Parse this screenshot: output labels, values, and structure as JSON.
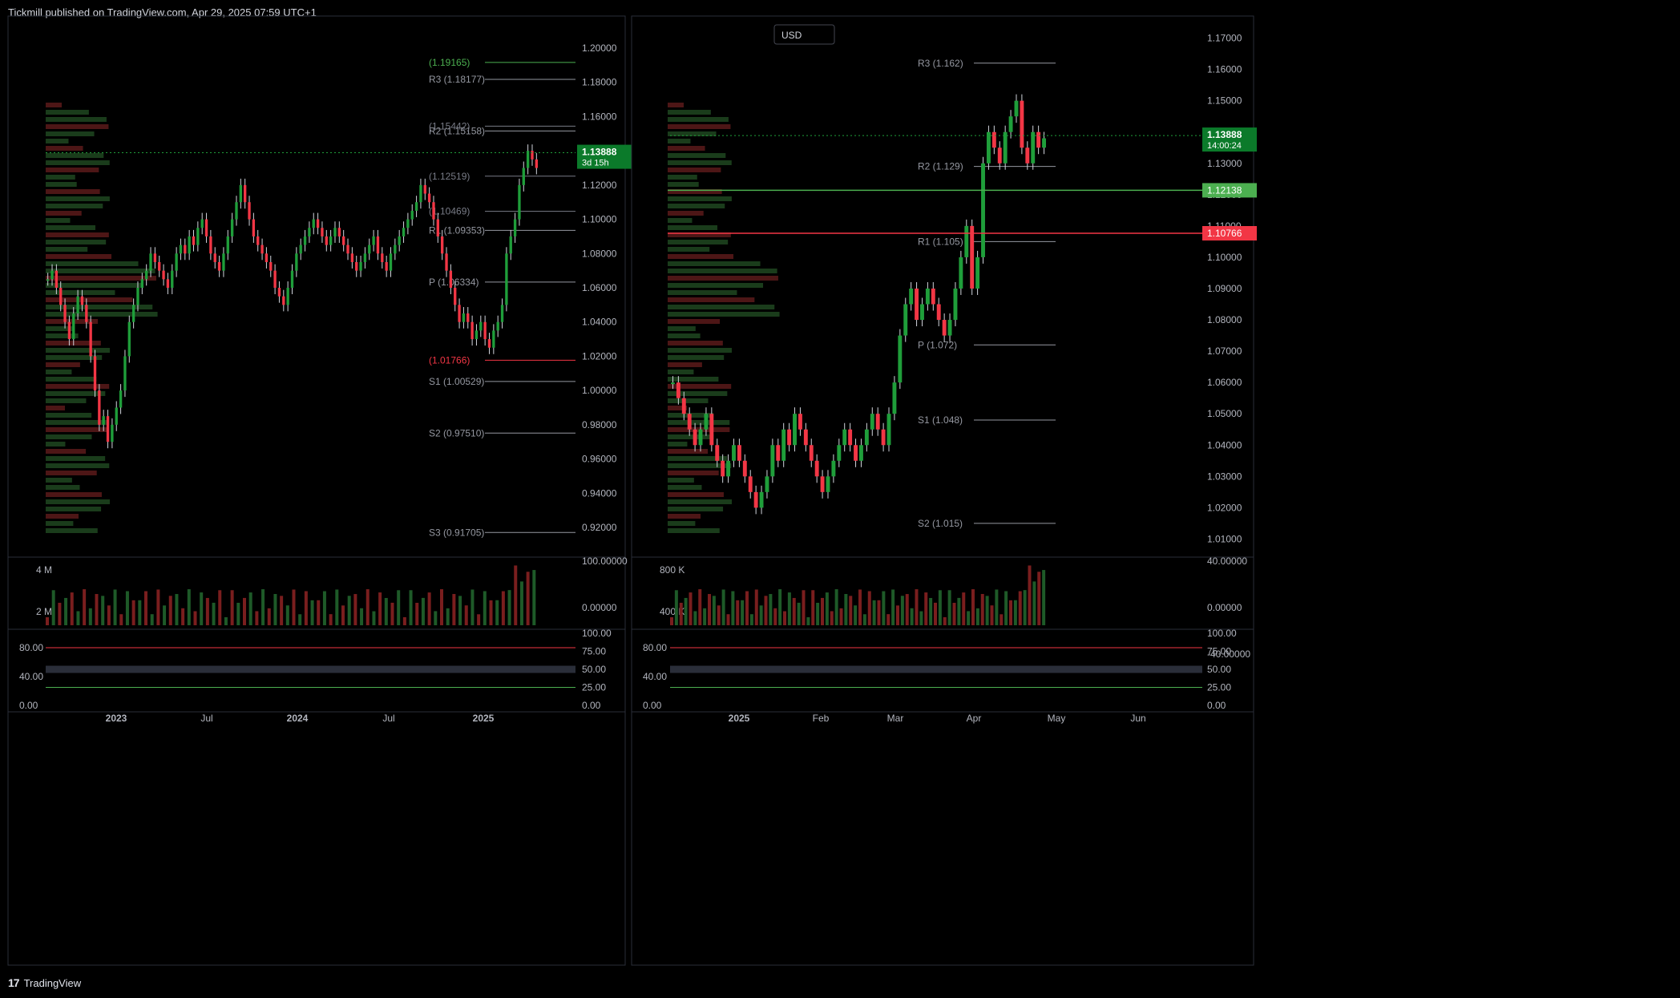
{
  "header": {
    "text": "Tickmill published on TradingView.com, Apr 29, 2025 07:59 UTC+1"
  },
  "footer": {
    "logo": "17",
    "brand": "TradingView"
  },
  "colors": {
    "bg": "#000000",
    "up": "#089981",
    "upBody": "#1f9e3a",
    "down": "#f23645",
    "grid": "#1c1c1c",
    "axis": "#b2b5be",
    "border": "#2a2e39"
  },
  "chart_data": [
    {
      "type": "candlestick",
      "name_on_chart": "",
      "currency_badge": "USD",
      "y_ticks": [
        "1.20000",
        "1.18000",
        "1.16000",
        "1.14000",
        "1.12000",
        "1.10000",
        "1.08000",
        "1.06000",
        "1.04000",
        "1.02000",
        "1.00000",
        "0.98000",
        "0.96000",
        "0.94000",
        "0.92000"
      ],
      "ylim": [
        0.905,
        1.215
      ],
      "x_labels": [
        "2023",
        "Jul",
        "2024",
        "Jul",
        "2025"
      ],
      "price_label": {
        "value": "1.13888",
        "sub": "3d 15h",
        "price": 1.13888
      },
      "levels": [
        {
          "label": "(1.19165)",
          "value": 1.19165,
          "color": "#4caf50"
        },
        {
          "label": "R3 (1.18177)",
          "value": 1.18177,
          "color": "#9598a1"
        },
        {
          "label": "R2 (1.15158)",
          "value": 1.15158,
          "color": "#9598a1"
        },
        {
          "label": "(1.15442)",
          "value": 1.15442,
          "color": "#787b86"
        },
        {
          "label": "(1.12519)",
          "value": 1.12519,
          "color": "#787b86"
        },
        {
          "label": "(1.10469)",
          "value": 1.10469,
          "color": "#787b86"
        },
        {
          "label": "R1 (1.09353)",
          "value": 1.09353,
          "color": "#9598a1"
        },
        {
          "label": "P (1.06334)",
          "value": 1.06334,
          "color": "#9598a1"
        },
        {
          "label": "(1.01766)",
          "value": 1.01766,
          "color": "#f23645"
        },
        {
          "label": "S1 (1.00529)",
          "value": 1.00529,
          "color": "#9598a1"
        },
        {
          "label": "S2 (0.97510)",
          "value": 0.9751,
          "color": "#9598a1"
        },
        {
          "label": "S3 (0.91705)",
          "value": 0.91705,
          "color": "#9598a1"
        }
      ],
      "candles": [
        1.065,
        1.07,
        1.06,
        1.05,
        1.04,
        1.03,
        1.045,
        1.055,
        1.05,
        1.04,
        1.02,
        1.0,
        0.98,
        0.985,
        0.97,
        0.98,
        0.99,
        1.0,
        1.02,
        1.04,
        1.05,
        1.06,
        1.065,
        1.07,
        1.08,
        1.075,
        1.07,
        1.065,
        1.06,
        1.07,
        1.08,
        1.085,
        1.08,
        1.09,
        1.085,
        1.095,
        1.1,
        1.09,
        1.08,
        1.075,
        1.07,
        1.08,
        1.09,
        1.1,
        1.11,
        1.12,
        1.11,
        1.1,
        1.09,
        1.085,
        1.08,
        1.075,
        1.07,
        1.06,
        1.055,
        1.05,
        1.06,
        1.07,
        1.08,
        1.085,
        1.09,
        1.095,
        1.1,
        1.095,
        1.09,
        1.085,
        1.09,
        1.095,
        1.09,
        1.085,
        1.08,
        1.075,
        1.07,
        1.075,
        1.08,
        1.085,
        1.09,
        1.08,
        1.075,
        1.07,
        1.08,
        1.085,
        1.09,
        1.095,
        1.1,
        1.105,
        1.11,
        1.12,
        1.115,
        1.11,
        1.1,
        1.09,
        1.08,
        1.07,
        1.06,
        1.05,
        1.04,
        1.045,
        1.04,
        1.03,
        1.035,
        1.04,
        1.03,
        1.025,
        1.035,
        1.04,
        1.05,
        1.08,
        1.09,
        1.1,
        1.12,
        1.13,
        1.14,
        1.135,
        1.13
      ],
      "volume_ticks": [
        "4 M",
        "2 M"
      ],
      "volume_right_ticks": [
        "100.00000",
        "0.00000"
      ],
      "osc_ticks": [
        "80.00",
        "40.00",
        "0.00"
      ],
      "osc_right_ticks": [
        "100.00",
        "75.00",
        "50.00",
        "25.00",
        "0.00"
      ]
    },
    {
      "type": "candlestick",
      "name_on_chart": "",
      "y_ticks": [
        "1.17000",
        "1.16000",
        "1.15000",
        "1.14000",
        "1.13000",
        "1.12000",
        "1.11000",
        "1.10000",
        "1.09000",
        "1.08000",
        "1.07000",
        "1.06000",
        "1.05000",
        "1.04000",
        "1.03000",
        "1.02000",
        "1.01000"
      ],
      "ylim": [
        1.0055,
        1.175
      ],
      "x_labels": [
        "2025",
        "Feb",
        "Mar",
        "Apr",
        "May",
        "Jun"
      ],
      "price_label": {
        "value": "1.13888",
        "sub": "14:00:24",
        "price": 1.13888
      },
      "side_labels": [
        {
          "value": "1.12138",
          "price": 1.12138,
          "color": "#4caf50"
        },
        {
          "value": "1.10766",
          "price": 1.10766,
          "color": "#f23645"
        }
      ],
      "levels": [
        {
          "label": "R3 (1.162)",
          "value": 1.162,
          "color": "#9598a1"
        },
        {
          "label": "R2 (1.129)",
          "value": 1.129,
          "color": "#9598a1"
        },
        {
          "label": "R1 (1.105)",
          "value": 1.105,
          "color": "#9598a1"
        },
        {
          "label": "P (1.072)",
          "value": 1.072,
          "color": "#9598a1"
        },
        {
          "label": "S1 (1.048)",
          "value": 1.048,
          "color": "#9598a1"
        },
        {
          "label": "S2 (1.015)",
          "value": 1.015,
          "color": "#9598a1"
        }
      ],
      "candles": [
        1.06,
        1.055,
        1.05,
        1.045,
        1.04,
        1.045,
        1.05,
        1.04,
        1.035,
        1.03,
        1.035,
        1.04,
        1.035,
        1.03,
        1.025,
        1.02,
        1.025,
        1.03,
        1.04,
        1.035,
        1.045,
        1.04,
        1.05,
        1.045,
        1.04,
        1.035,
        1.03,
        1.025,
        1.03,
        1.035,
        1.04,
        1.045,
        1.04,
        1.035,
        1.04,
        1.045,
        1.05,
        1.045,
        1.04,
        1.05,
        1.06,
        1.075,
        1.085,
        1.09,
        1.08,
        1.085,
        1.09,
        1.085,
        1.08,
        1.075,
        1.08,
        1.09,
        1.1,
        1.11,
        1.09,
        1.1,
        1.13,
        1.14,
        1.135,
        1.13,
        1.14,
        1.145,
        1.15,
        1.135,
        1.13,
        1.14,
        1.135,
        1.138
      ],
      "volume_ticks": [
        "800 K",
        "400 K"
      ],
      "volume_right_ticks": [
        "40.00000",
        "0.00000",
        "-40.00000"
      ],
      "osc_ticks": [
        "80.00",
        "40.00",
        "0.00"
      ],
      "osc_right_ticks": [
        "100.00",
        "75.00",
        "50.00",
        "25.00",
        "0.00"
      ]
    }
  ]
}
